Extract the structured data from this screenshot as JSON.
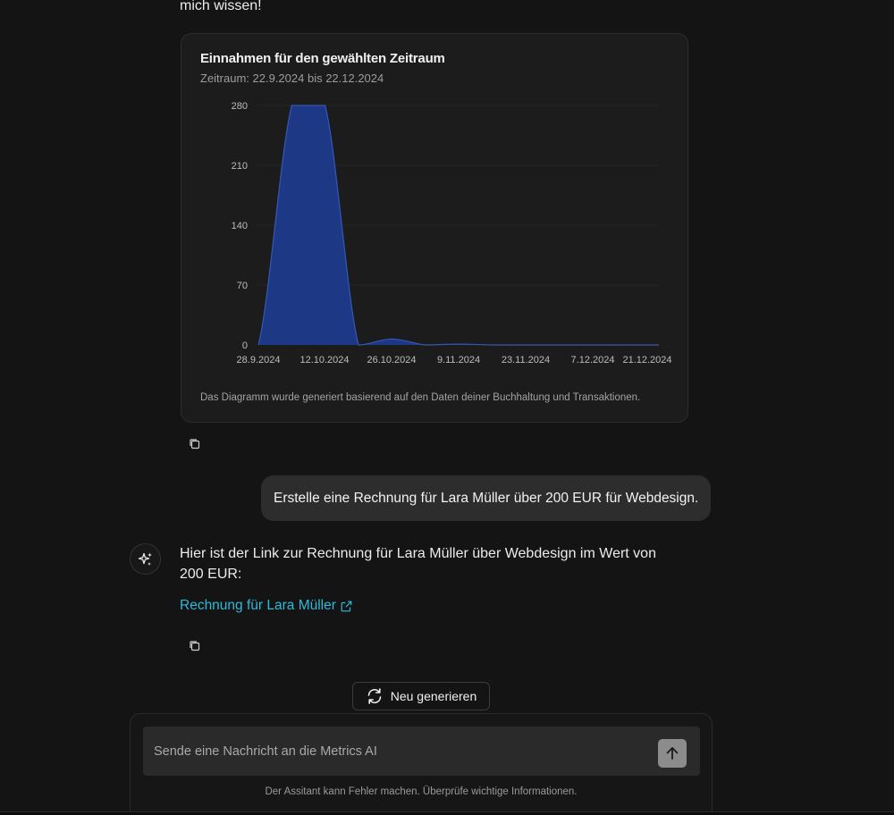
{
  "partial_message": "mich wissen!",
  "chart_card": {
    "title": "Einnahmen für den gewählten Zeitraum",
    "subtitle": "Zeitraum: 22.9.2024 bis 22.12.2024",
    "footnote": "Das Diagramm wurde generiert basierend auf den Daten deiner Buchhaltung und Transaktionen."
  },
  "chart_data": {
    "type": "area",
    "title": "Einnahmen für den gewählten Zeitraum",
    "subtitle": "Zeitraum: 22.9.2024 bis 22.12.2024",
    "xlabel": "",
    "ylabel": "",
    "x_ticks": [
      "28.9.2024",
      "12.10.2024",
      "26.10.2024",
      "9.11.2024",
      "23.11.2024",
      "7.12.2024",
      "21.12.2024"
    ],
    "y_ticks": [
      0,
      70,
      140,
      210,
      280
    ],
    "ylim": [
      0,
      280
    ],
    "grid": true,
    "color": "#1e3a8a",
    "stroke": "#3558b8",
    "points": [
      {
        "x": "28.9.2024",
        "y": 0
      },
      {
        "x": "5.10.2024",
        "y": 280
      },
      {
        "x": "12.10.2024",
        "y": 280
      },
      {
        "x": "19.10.2024",
        "y": 0
      },
      {
        "x": "26.10.2024",
        "y": 7
      },
      {
        "x": "2.11.2024",
        "y": 0
      },
      {
        "x": "9.11.2024",
        "y": 1
      },
      {
        "x": "16.11.2024",
        "y": 0
      },
      {
        "x": "23.11.2024",
        "y": 0
      },
      {
        "x": "30.11.2024",
        "y": 0
      },
      {
        "x": "7.12.2024",
        "y": 0
      },
      {
        "x": "14.12.2024",
        "y": 0
      },
      {
        "x": "21.12.2024",
        "y": 0
      }
    ]
  },
  "user_message": "Erstelle eine Rechnung für Lara Müller über 200 EUR für Webdesign.",
  "ai_message": {
    "text": "Hier ist der Link zur Rechnung für Lara Müller über Webdesign im Wert von 200 EUR:",
    "link_label": "Rechnung für Lara Müller"
  },
  "regenerate_label": "Neu generieren",
  "composer": {
    "placeholder": "Sende eine Nachricht an die Metrics AI",
    "disclaimer": "Der Assitant kann Fehler machen. Überprüfe wichtige Informationen."
  },
  "icons": {
    "copy": "copy-icon",
    "ai": "sparkles-icon",
    "external": "external-link-icon",
    "regenerate": "refresh-icon",
    "send": "arrow-up-icon"
  }
}
